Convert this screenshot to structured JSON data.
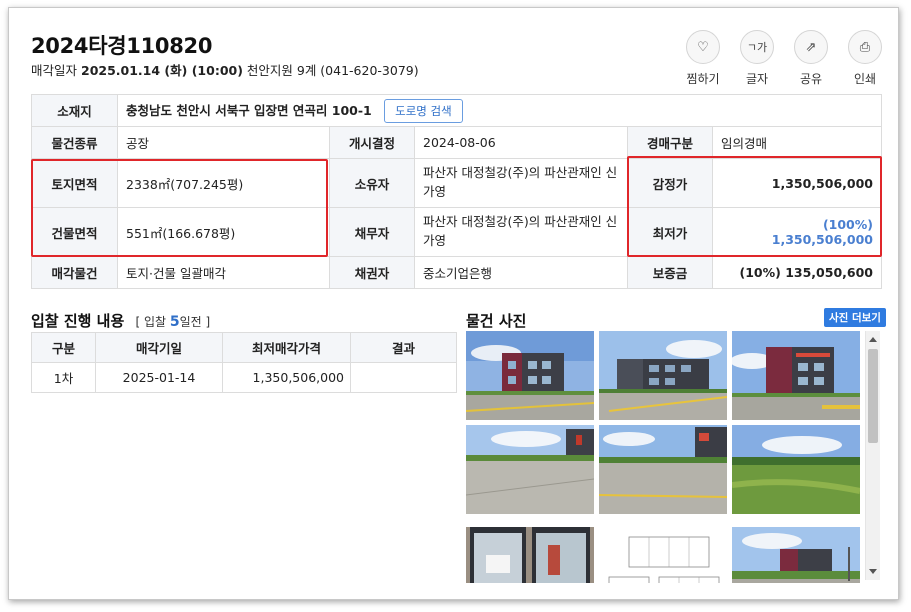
{
  "header": {
    "case_number": "2024타경110820",
    "sale_date_label": "매각일자",
    "sale_date": "2025.01.14 (화) (10:00)",
    "court": "천안지원 9계 (041-620-3079)"
  },
  "actions": [
    {
      "label": "찜하기",
      "icon": "heart-icon",
      "glyph": "♡"
    },
    {
      "label": "글자",
      "icon": "font-size-icon",
      "glyph": "ㄱ가"
    },
    {
      "label": "공유",
      "icon": "share-icon",
      "glyph": "⇗"
    },
    {
      "label": "인쇄",
      "icon": "print-icon",
      "glyph": "⎙"
    }
  ],
  "info": {
    "location_label": "소재지",
    "location": "충청남도 천안시 서북구 입장면 연곡리 100-1",
    "road_search": "도로명 검색",
    "type_label": "물건종류",
    "type": "공장",
    "start_label": "개시결정",
    "start": "2024-08-06",
    "auction_type_label": "경매구분",
    "auction_type": "임의경매",
    "land_area_label": "토지면적",
    "land_area": "2338㎡(707.245평)",
    "owner_label": "소유자",
    "owner": "파산자 대정철강(주)의 파산관재인 신가영",
    "appraisal_label": "감정가",
    "appraisal": "1,350,506,000",
    "building_area_label": "건물면적",
    "building_area": "551㎡(166.678평)",
    "debtor_label": "채무자",
    "debtor": "파산자 대정철강(주)의 파산관재인 신가영",
    "min_price_label": "최저가",
    "min_price": "(100%) 1,350,506,000",
    "sale_item_label": "매각물건",
    "sale_item": "토지·건물 일괄매각",
    "creditor_label": "채권자",
    "creditor": "중소기업은행",
    "deposit_label": "보증금",
    "deposit": "(10%) 135,050,600"
  },
  "bid": {
    "title": "입찰 진행 내용",
    "sub_prefix": "[ 입찰 ",
    "sub_days": "5",
    "sub_suffix": "일전 ]",
    "headers": [
      "구분",
      "매각기일",
      "최저매각가격",
      "결과"
    ],
    "rows": [
      {
        "round": "1차",
        "date": "2025-01-14",
        "price": "1,350,506,000",
        "result": ""
      }
    ]
  },
  "photos": {
    "title": "물건 사진",
    "more": "사진 더보기"
  }
}
